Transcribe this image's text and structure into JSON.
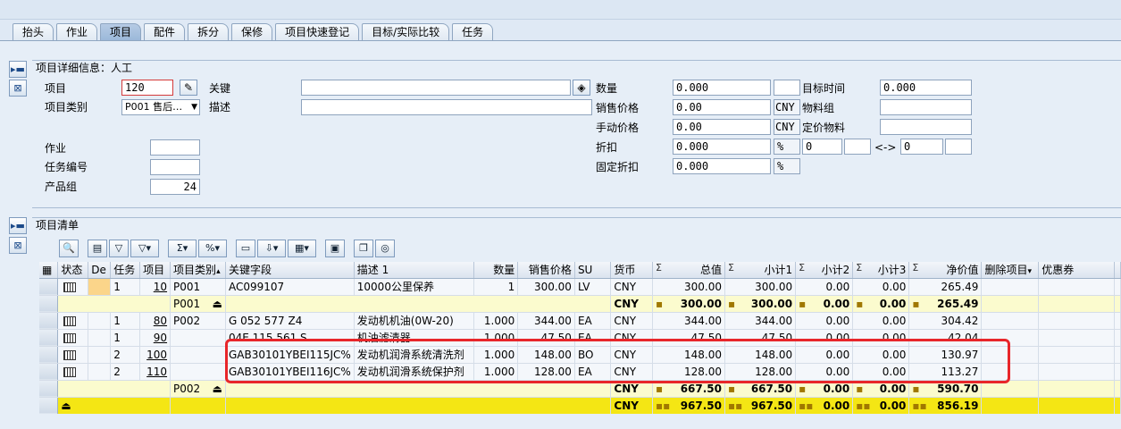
{
  "tabs": [
    "抬头",
    "作业",
    "项目",
    "配件",
    "拆分",
    "保修",
    "项目快速登记",
    "目标/实际比较",
    "任务"
  ],
  "active_tab": 2,
  "detail": {
    "title": "项目详细信息：人工",
    "item_label": "项目",
    "item_value": "120",
    "item_cat_label": "项目类别",
    "item_cat_value": "P001 售后…",
    "keyword_label": "关键",
    "keyword_value": "",
    "desc_label": "描述",
    "desc_value": "",
    "activity_label": "作业",
    "task_no_label": "任务编号",
    "product_group_label": "产品组",
    "product_group_value": "24",
    "qty_label": "数量",
    "qty_value": "0.000",
    "qty_unit": "",
    "target_time_label": "目标时间",
    "target_time_value": "0.000",
    "sales_price_label": "销售价格",
    "sales_price_value": "0.00",
    "sales_currency": "CNY",
    "material_group_label": "物料组",
    "manual_price_label": "手动价格",
    "manual_price_value": "0.00",
    "manual_currency": "CNY",
    "pricing_material_label": "定价物料",
    "discount_label": "折扣",
    "discount_value": "0.000",
    "discount_unit": "%",
    "discount_from": "0",
    "discount_arrow": "<->",
    "discount_to": "0",
    "fixed_discount_label": "固定折扣",
    "fixed_discount_value": "0.000",
    "fixed_discount_unit": "%"
  },
  "list": {
    "title": "项目清单",
    "headers": [
      "状态",
      "De",
      "任务",
      "项目",
      "项目类别",
      "关键字段",
      "描述 1",
      "数量",
      "销售价格",
      "SU",
      "货币",
      "总值",
      "小计1",
      "小计2",
      "小计3",
      "净价值",
      "删除项目",
      "优惠券"
    ],
    "rows": [
      {
        "type": "item",
        "status": true,
        "task": "1",
        "item": "10",
        "cat": "P001",
        "key": "AC099107",
        "desc": "10000公里保养",
        "qty": "1",
        "price": "300.00",
        "su": "LV",
        "cur": "CNY",
        "total": "300.00",
        "s1": "300.00",
        "s2": "0.00",
        "s3": "0.00",
        "net": "265.49"
      },
      {
        "type": "sum",
        "cat": "P001",
        "cur": "CNY",
        "total": "300.00",
        "s1": "300.00",
        "s2": "0.00",
        "s3": "0.00",
        "net": "265.49"
      },
      {
        "type": "item",
        "status": true,
        "task": "1",
        "item": "80",
        "cat": "P002",
        "key": "G  052 577 Z4",
        "desc": "发动机机油(0W-20)",
        "qty": "1.000",
        "price": "344.00",
        "su": "EA",
        "cur": "CNY",
        "total": "344.00",
        "s1": "344.00",
        "s2": "0.00",
        "s3": "0.00",
        "net": "304.42"
      },
      {
        "type": "item",
        "status": true,
        "task": "1",
        "item": "90",
        "cat": "",
        "key": "04E 115 561 S",
        "desc": "机油滤清器",
        "qty": "1.000",
        "price": "47.50",
        "su": "EA",
        "cur": "CNY",
        "total": "47.50",
        "s1": "47.50",
        "s2": "0.00",
        "s3": "0.00",
        "net": "42.04"
      },
      {
        "type": "item",
        "status": true,
        "task": "2",
        "item": "100",
        "cat": "",
        "key": "GAB30101YBEI115JC%",
        "desc": "发动机润滑系统清洗剂",
        "qty": "1.000",
        "price": "148.00",
        "su": "BO",
        "cur": "CNY",
        "total": "148.00",
        "s1": "148.00",
        "s2": "0.00",
        "s3": "0.00",
        "net": "130.97"
      },
      {
        "type": "item",
        "status": true,
        "task": "2",
        "item": "110",
        "cat": "",
        "key": "GAB30101YBEI116JC%",
        "desc": "发动机润滑系统保护剂",
        "qty": "1.000",
        "price": "128.00",
        "su": "EA",
        "cur": "CNY",
        "total": "128.00",
        "s1": "128.00",
        "s2": "0.00",
        "s3": "0.00",
        "net": "113.27"
      },
      {
        "type": "sum",
        "cat": "P002",
        "cur": "CNY",
        "total": "667.50",
        "s1": "667.50",
        "s2": "0.00",
        "s3": "0.00",
        "net": "590.70"
      },
      {
        "type": "total",
        "cat": "",
        "cur": "CNY",
        "total": "967.50",
        "s1": "967.50",
        "s2": "0.00",
        "s3": "0.00",
        "net": "856.19"
      }
    ]
  }
}
